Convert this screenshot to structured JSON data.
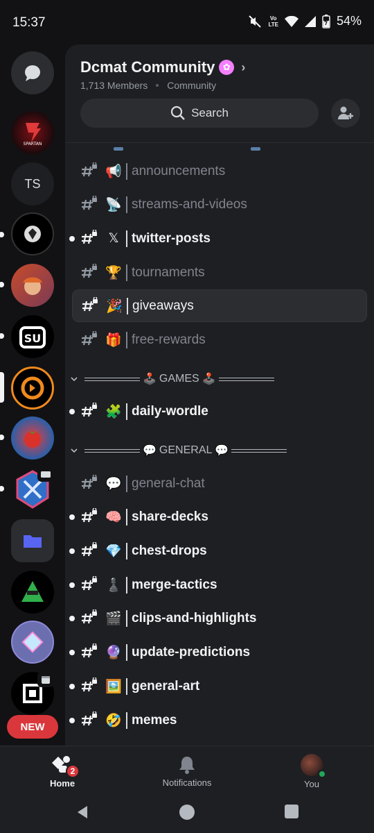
{
  "status_bar": {
    "time": "15:37",
    "volte_top": "Vo",
    "volte_bottom": "LTE",
    "battery": "54%",
    "icons": [
      "mute-icon",
      "volte-icon",
      "wifi-icon",
      "signal-icon",
      "battery-charging-icon"
    ]
  },
  "rail": {
    "ts_label": "TS",
    "new_label": "NEW"
  },
  "guild": {
    "name": "Dcmat Community",
    "members": "1,713 Members",
    "type": "Community"
  },
  "search": {
    "label": "Search"
  },
  "channels": {
    "announcements": {
      "emoji": "📢",
      "name": "announcements"
    },
    "streams": {
      "emoji": "📡",
      "name": "streams-and-videos"
    },
    "twitter": {
      "emoji": "𝕏",
      "name": "twitter-posts"
    },
    "tournaments": {
      "emoji": "🏆",
      "name": "tournaments"
    },
    "giveaways": {
      "emoji": "🎉",
      "name": "giveaways"
    },
    "free_rewards": {
      "emoji": "🎁",
      "name": "free-rewards"
    },
    "daily_wordle": {
      "emoji": "🧩",
      "name": "daily-wordle"
    },
    "general_chat": {
      "emoji": "💬",
      "name": "general-chat"
    },
    "share_decks": {
      "emoji": "🧠",
      "name": "share-decks"
    },
    "chest_drops": {
      "emoji": "💎",
      "name": "chest-drops"
    },
    "merge_tactics": {
      "emoji": "♟️",
      "name": "merge-tactics"
    },
    "clips": {
      "emoji": "🎬",
      "name": "clips-and-highlights"
    },
    "update_predictions": {
      "emoji": "🔮",
      "name": "update-predictions"
    },
    "general_art": {
      "emoji": "🖼️",
      "name": "general-art"
    },
    "memes": {
      "emoji": "🤣",
      "name": "memes"
    }
  },
  "categories": {
    "games": {
      "emoji": "🕹️",
      "label": "GAMES"
    },
    "general": {
      "emoji": "💬",
      "label": "GENERAL"
    }
  },
  "bottom_nav": {
    "home": "Home",
    "home_badge": "2",
    "notifications": "Notifications",
    "you": "You"
  },
  "colors": {
    "background": "#1e1f22",
    "rail": "#121214",
    "accent": "#5865f2",
    "danger": "#da373c",
    "online": "#23a55a"
  }
}
